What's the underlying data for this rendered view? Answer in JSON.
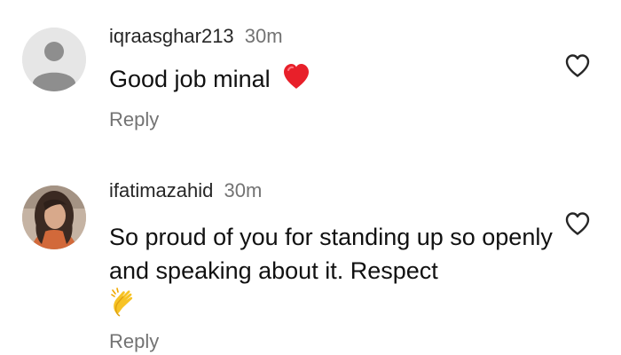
{
  "comments": [
    {
      "username": "iqraasghar213",
      "time": "30m",
      "text": "Good job minal",
      "emoji": "red-heart",
      "reply_label": "Reply",
      "avatar": "default-user-avatar",
      "like_icon": "heart-outline-icon"
    },
    {
      "username": "ifatimazahid",
      "time": "30m",
      "text": "So proud of you for standing up so openly and speaking about it. Respect",
      "emoji": "clapping-hands",
      "reply_label": "Reply",
      "avatar": "user-photo-avatar",
      "like_icon": "heart-outline-icon"
    }
  ],
  "colors": {
    "username": "#262626",
    "secondary_text": "#737373",
    "body_text": "#111111",
    "heart_emoji": "#e8202a",
    "clap_emoji": "#f7c325"
  }
}
